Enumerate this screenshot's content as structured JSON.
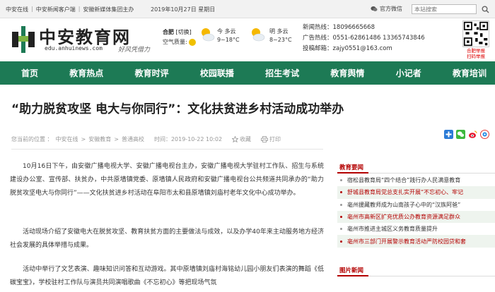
{
  "topbar": {
    "links": [
      "中安在线",
      "中安新闻客户端",
      "安徽新媒体集团主办"
    ],
    "date": "2019年10月27日 星期日",
    "wechat_label": "官方微信",
    "search_placeholder": "本站搜索"
  },
  "header": {
    "logo_text": "中安教育网",
    "logo_url": "edu.anhuinews.com",
    "slogan": "好风凭借力",
    "weather": {
      "city": "合肥",
      "switch_label": "[切换]",
      "air_label": "空气质量:",
      "today_label": "今 多云",
      "today_temp": "9~18°C",
      "tomorrow_label": "明 多云",
      "tomorrow_temp": "8~23°C"
    },
    "contact": {
      "news_hotline": "新闻热线：18096665668",
      "ad_hotline": "广告热线：0551-62861486 13365743846",
      "email": "投稿邮箱：zajy0551@163.com"
    },
    "qr_label": "合肥举报\n扫码举报"
  },
  "nav": [
    "首页",
    "教育热点",
    "教育时评",
    "校园联播",
    "招生考试",
    "教育舆情",
    "小记者",
    "教育培训"
  ],
  "article": {
    "title": "“助力脱贫攻坚 电大与你同行”：文化扶贫进乡村活动成功举办",
    "meta": {
      "location_label": "您当前的位置 ：",
      "crumb1": "中安在线",
      "crumb2": "安徽教育",
      "crumb3": "普通高校",
      "time": "时间：2019-10-22 10:02",
      "favorite": "收藏",
      "print": "打印"
    },
    "paragraphs": [
      "10月16日下午，由安徽广播电视大学、安徽广播电视台主办，安徽广播电视大学驻村工作队、招生与系统建设办公室、宣传部、扶贫办，中共原墙镇党委、原墙镇人民政府和安徽广播电视台公共频道共同承办的“助力脱贫攻坚电大与你同行”——文化扶贫进乡村活动在阜阳市太和县原墙镇刘庙村老年文化中心成功举办。",
      "活动现场介绍了安徽电大在脱贫攻坚、教育扶贫方面的主要做法与成效，以及办学40年来主动服务地方经济社会发展的具体举措与成果。",
      "活动中举行了文艺表演、趣味知识问答和互动游戏。其中原墙镇刘庙村海铭幼儿园小朋友们表演的舞蹈《低碳宝宝》，学校驻村工作队与演员共同演唱歌曲《不忘初心》等把现场气氛"
    ]
  },
  "sidebar": {
    "section1_title": "教育要闻",
    "news": [
      "宿松县教育局“四个结合”践行办人民满意教育",
      "舒城县教育局党总支扎实开展“不忘初心、牢记",
      "亳州援藏教师成为山南孩子心中的“汉族阿爸”",
      "亳州市高新区扩充优质公办教育资源满足群众",
      "亳州市推进主城区义务教育质量提升",
      "亳州市三部门开展警示教育活动严防校园贷和套"
    ],
    "section2_title": "图片新闻"
  },
  "colors": {
    "nav_bg": "#1d7a55",
    "accent_red": "#b30000"
  }
}
